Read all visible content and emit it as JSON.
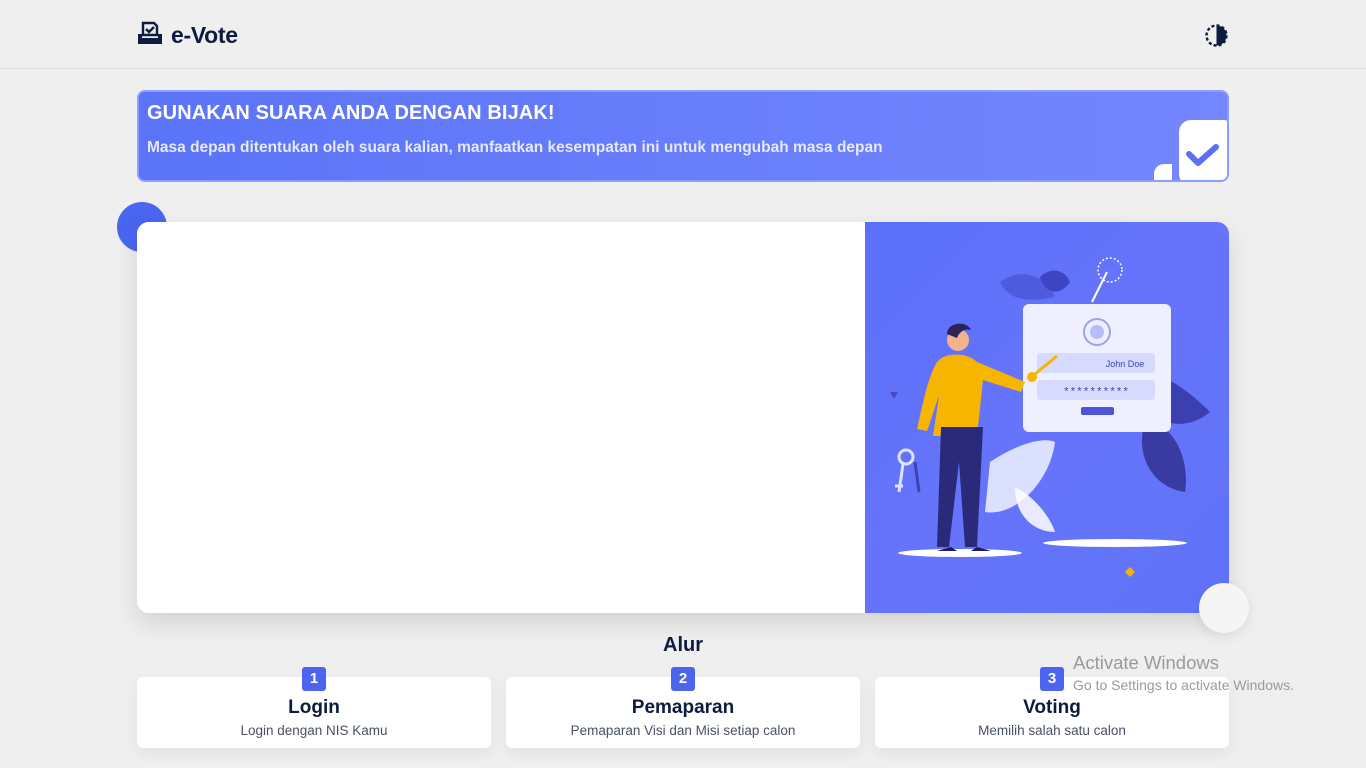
{
  "header": {
    "app_name": "e-Vote",
    "logo_icon": "ballot-box-icon",
    "theme_icon": "contrast-toggle-icon"
  },
  "hero": {
    "title": "GUNAKAN SUARA ANDA DENGAN BIJAK!",
    "subtitle": "Masa depan ditentukan oleh suara kalian, manfaatkan kesempatan ini untuk mengubah masa depan",
    "decor_icon": "checkmark-icon"
  },
  "illustration": {
    "name_field": "John Doe",
    "password_field": "**********",
    "icon": "login-illustration"
  },
  "flow": {
    "title": "Alur",
    "steps": [
      {
        "number": "1",
        "title": "Login",
        "description": "Login dengan NIS Kamu"
      },
      {
        "number": "2",
        "title": "Pemaparan",
        "description": "Pemaparan Visi dan Misi setiap calon"
      },
      {
        "number": "3",
        "title": "Voting",
        "description": "Memilih salah satu calon"
      }
    ]
  },
  "windows_notice": {
    "title": "Activate Windows",
    "subtitle": "Go to Settings to activate Windows."
  },
  "colors": {
    "accent": "#4d64ee",
    "hero_gradient_start": "#5b74f8",
    "hero_gradient_end": "#7487ff",
    "text_dark": "#0d1b3e",
    "background": "#efefef"
  }
}
